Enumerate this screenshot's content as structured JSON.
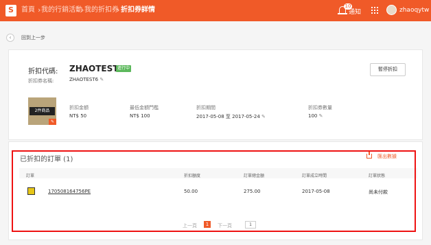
{
  "nav": {
    "logo_letter": "S",
    "crumbs": [
      "首頁",
      "我的行銷活動",
      "我的折扣券"
    ],
    "current": "折扣券詳情",
    "notify_count": "10",
    "notify_label": "通知",
    "username": "zhaoqytw"
  },
  "back": {
    "label": "回到上一步"
  },
  "voucher": {
    "code_label": "折扣代碼:",
    "code": "ZHAOTEST6",
    "status": "進行中",
    "name_label": "折扣券名稱:",
    "name": "ZHAOTEST6",
    "stop_button": "暫停折扣",
    "thumb_text": "2件商品",
    "amount_label": "折扣金額",
    "amount": "NT$ 50",
    "min_label": "最低金額門檻",
    "min": "NT$ 100",
    "period_label": "折扣期間",
    "period": "2017-05-08 至 2017-05-24",
    "qty_label": "折扣券數量",
    "qty": "100"
  },
  "orders": {
    "title": "已折扣的訂單 (1)",
    "export_label": "匯出數據",
    "columns": [
      "訂單",
      "折扣額度",
      "訂單總金額",
      "訂單成立時間",
      "訂單狀態"
    ],
    "rows": [
      {
        "order_id": "170508164756PE",
        "discount": "50.00",
        "total": "275.00",
        "created": "2017-05-08",
        "status": "尚未付款"
      }
    ],
    "pagination": {
      "prev": "上一頁",
      "current": "1",
      "next": "下一頁",
      "goto": "1"
    }
  },
  "colors": {
    "brand": "#f05a28",
    "status_green": "#5cb85c",
    "highlight": "#e11111"
  },
  "icons": [
    "shopee-bag-icon",
    "bell-icon",
    "apps-grid-icon",
    "avatar",
    "back-arrow-icon",
    "edit-pencil-icon",
    "export-icon",
    "order-thumb-icon"
  ]
}
